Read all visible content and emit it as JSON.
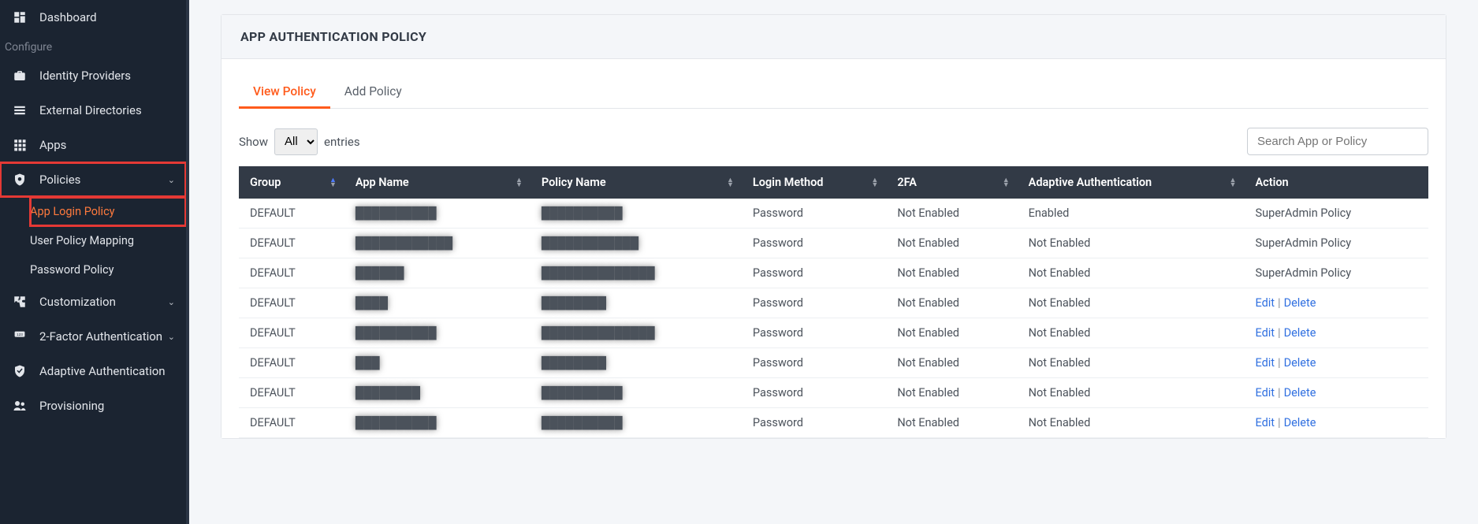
{
  "sidebar": {
    "items": [
      {
        "id": "dashboard",
        "label": "Dashboard",
        "icon": "dashboard"
      }
    ],
    "section_label": "Configure",
    "configure": [
      {
        "id": "idp",
        "label": "Identity Providers",
        "icon": "briefcase"
      },
      {
        "id": "extdir",
        "label": "External Directories",
        "icon": "list"
      },
      {
        "id": "apps",
        "label": "Apps",
        "icon": "grid"
      },
      {
        "id": "policies",
        "label": "Policies",
        "icon": "shield",
        "expandable": true,
        "highlight": true,
        "children": [
          {
            "id": "app-login-policy",
            "label": "App Login Policy",
            "active": true,
            "highlight": true
          },
          {
            "id": "user-policy-mapping",
            "label": "User Policy Mapping"
          },
          {
            "id": "password-policy",
            "label": "Password Policy"
          }
        ]
      },
      {
        "id": "customization",
        "label": "Customization",
        "icon": "puzzle",
        "expandable": true
      },
      {
        "id": "2fa",
        "label": "2-Factor Authentication",
        "icon": "badge123",
        "expandable": true
      },
      {
        "id": "adaptive",
        "label": "Adaptive Authentication",
        "icon": "check-shield"
      },
      {
        "id": "provisioning",
        "label": "Provisioning",
        "icon": "users"
      }
    ]
  },
  "panel": {
    "title": "APP AUTHENTICATION POLICY",
    "tabs": [
      {
        "id": "view",
        "label": "View Policy",
        "active": true
      },
      {
        "id": "add",
        "label": "Add Policy"
      }
    ],
    "entries": {
      "show_label": "Show",
      "entries_label": "entries",
      "select_value": "All"
    },
    "search_placeholder": "Search App or Policy",
    "columns": [
      "Group",
      "App Name",
      "Policy Name",
      "Login Method",
      "2FA",
      "Adaptive Authentication",
      "Action"
    ],
    "rows": [
      {
        "group": "DEFAULT",
        "app": "██████████",
        "policy": "██████████",
        "method": "Password",
        "tfa": "Not Enabled",
        "adaptive": "Enabled",
        "action_type": "text",
        "action_text": "SuperAdmin Policy"
      },
      {
        "group": "DEFAULT",
        "app": "████████████",
        "policy": "████████████",
        "method": "Password",
        "tfa": "Not Enabled",
        "adaptive": "Not Enabled",
        "action_type": "text",
        "action_text": "SuperAdmin Policy"
      },
      {
        "group": "DEFAULT",
        "app": "██████",
        "policy": "██████████████",
        "method": "Password",
        "tfa": "Not Enabled",
        "adaptive": "Not Enabled",
        "action_type": "text",
        "action_text": "SuperAdmin Policy"
      },
      {
        "group": "DEFAULT",
        "app": "████",
        "policy": "████████",
        "method": "Password",
        "tfa": "Not Enabled",
        "adaptive": "Not Enabled",
        "action_type": "links"
      },
      {
        "group": "DEFAULT",
        "app": "██████████",
        "policy": "██████████████",
        "method": "Password",
        "tfa": "Not Enabled",
        "adaptive": "Not Enabled",
        "action_type": "links"
      },
      {
        "group": "DEFAULT",
        "app": "███",
        "policy": "████████",
        "method": "Password",
        "tfa": "Not Enabled",
        "adaptive": "Not Enabled",
        "action_type": "links"
      },
      {
        "group": "DEFAULT",
        "app": "████████",
        "policy": "██████████",
        "method": "Password",
        "tfa": "Not Enabled",
        "adaptive": "Not Enabled",
        "action_type": "links"
      },
      {
        "group": "DEFAULT",
        "app": "██████████",
        "policy": "██████████",
        "method": "Password",
        "tfa": "Not Enabled",
        "adaptive": "Not Enabled",
        "action_type": "links"
      }
    ],
    "action_links": {
      "edit": "Edit",
      "delete": "Delete"
    }
  }
}
